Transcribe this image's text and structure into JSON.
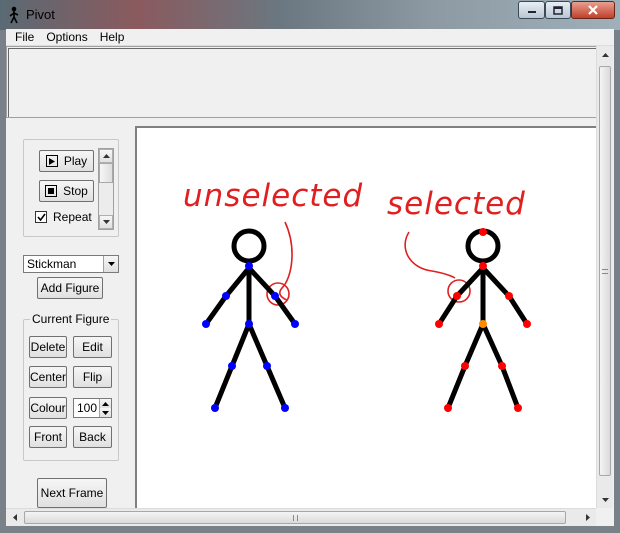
{
  "window": {
    "title": "Pivot",
    "controls": {
      "minimize": "minimize-icon",
      "maximize": "maximize-icon",
      "close": "close-icon"
    }
  },
  "menu": {
    "items": [
      "File",
      "Options",
      "Help"
    ]
  },
  "playback": {
    "play_label": "Play",
    "stop_label": "Stop",
    "repeat_label": "Repeat",
    "repeat_checked": true
  },
  "figure_select": {
    "value": "Stickman"
  },
  "add_figure_label": "Add Figure",
  "current_figure": {
    "legend": "Current Figure",
    "delete_label": "Delete",
    "edit_label": "Edit",
    "center_label": "Center",
    "flip_label": "Flip",
    "colour_label": "Colour",
    "colour_value": "100",
    "front_label": "Front",
    "back_label": "Back"
  },
  "next_frame_label": "Next Frame",
  "canvas": {
    "unselected_text": "unselected",
    "selected_text": "selected",
    "colors": {
      "figure": "#000000",
      "handle_unselected": "#0000ff",
      "handle_selected": "#ff0000",
      "handle_origin": "#ff8c00",
      "annotation": "#e02020"
    }
  }
}
